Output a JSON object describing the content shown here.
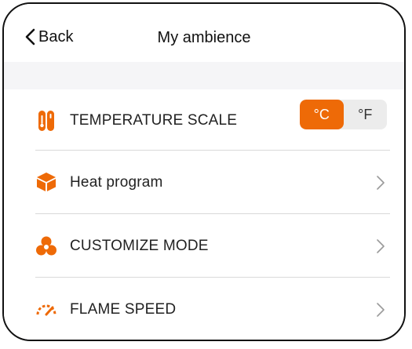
{
  "header": {
    "back_label": "Back",
    "title": "My ambience"
  },
  "colors": {
    "accent": "#ee6a07",
    "segment_bg": "#ececec",
    "page_bg": "#f5f5f7"
  },
  "settings": [
    {
      "icon": "thermometer-icon",
      "label": "TEMPERATURE SCALE",
      "control": "segmented",
      "options": [
        "°C",
        "°F"
      ],
      "selected": "°C"
    },
    {
      "icon": "box-icon",
      "label": "Heat program",
      "control": "chevron"
    },
    {
      "icon": "fan-icon",
      "label": "CUSTOMIZE MODE",
      "control": "chevron"
    },
    {
      "icon": "speedometer-icon",
      "label": "FLAME SPEED",
      "control": "chevron"
    }
  ]
}
